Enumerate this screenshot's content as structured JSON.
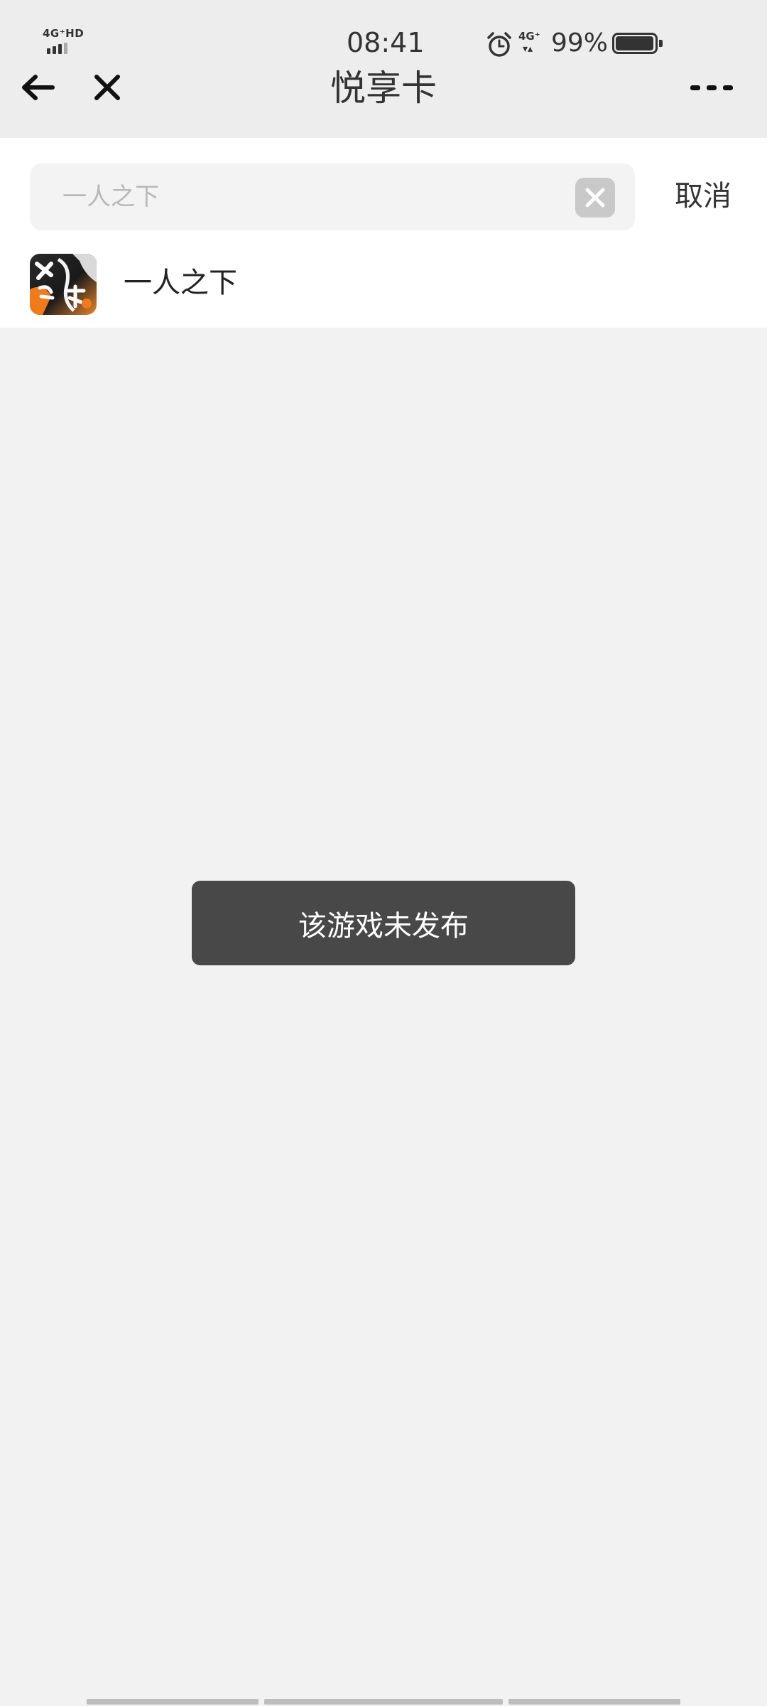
{
  "status_bar": {
    "network_label": "4G⁺HD",
    "time": "08:41",
    "network_type": "4G⁺",
    "battery_percent": "99%",
    "battery_level": 0.99
  },
  "nav": {
    "title": "悦享卡",
    "icons": {
      "back": "arrow-left-icon",
      "close": "close-icon",
      "more": "more-dots-icon"
    }
  },
  "search": {
    "placeholder": "一人之下",
    "value": "",
    "cancel_label": "取消"
  },
  "results": [
    {
      "name": "一人之下",
      "icon": "game-app-icon"
    }
  ],
  "toast": {
    "message": "该游戏未发布"
  },
  "colors": {
    "nav_background": "#ededed",
    "page_background": "#f2f2f2",
    "panel_background": "#ffffff",
    "toast_background": "#484848",
    "text_primary": "#333333"
  }
}
